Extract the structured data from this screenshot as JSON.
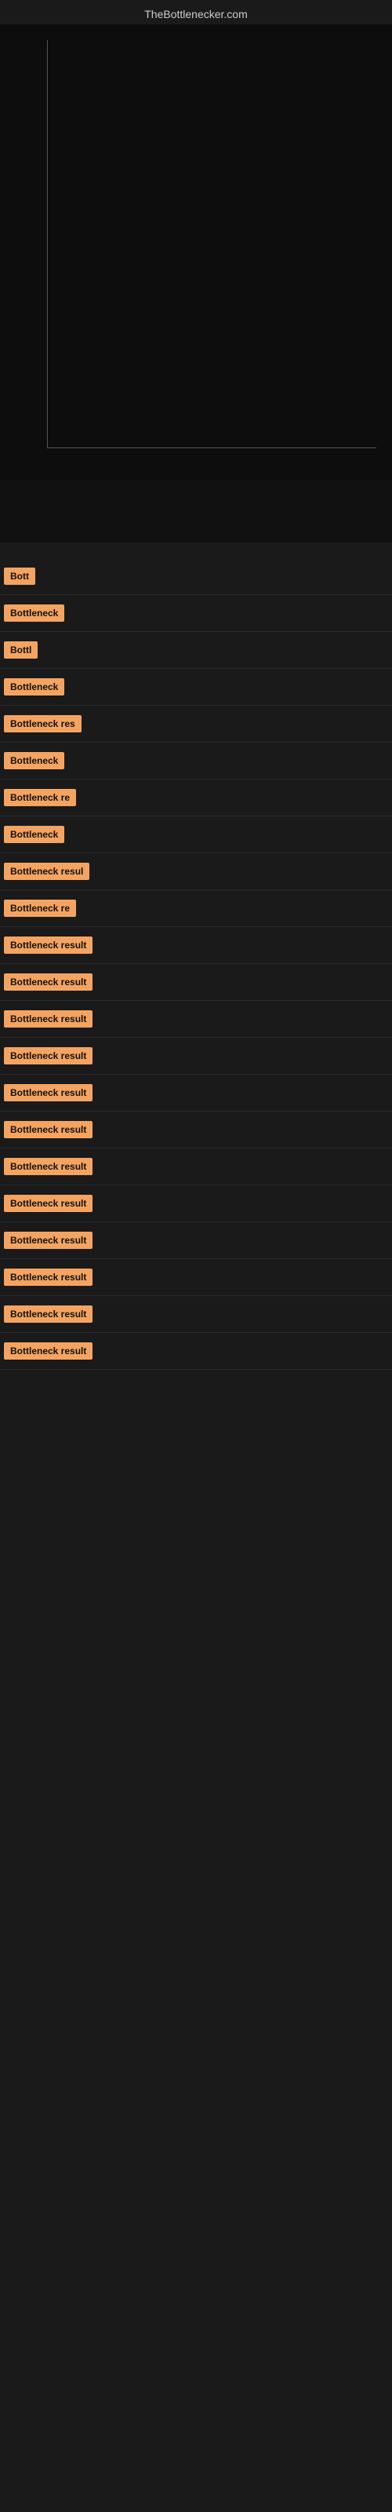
{
  "site": {
    "title": "TheBottlenecker.com"
  },
  "results": [
    {
      "id": 1,
      "label": "Bott",
      "full": false
    },
    {
      "id": 2,
      "label": "Bottleneck",
      "full": false
    },
    {
      "id": 3,
      "label": "Bottl",
      "full": false
    },
    {
      "id": 4,
      "label": "Bottleneck",
      "full": false
    },
    {
      "id": 5,
      "label": "Bottleneck res",
      "full": false
    },
    {
      "id": 6,
      "label": "Bottleneck",
      "full": false
    },
    {
      "id": 7,
      "label": "Bottleneck re",
      "full": false
    },
    {
      "id": 8,
      "label": "Bottleneck",
      "full": false
    },
    {
      "id": 9,
      "label": "Bottleneck resul",
      "full": false
    },
    {
      "id": 10,
      "label": "Bottleneck re",
      "full": false
    },
    {
      "id": 11,
      "label": "Bottleneck result",
      "full": true
    },
    {
      "id": 12,
      "label": "Bottleneck result",
      "full": true
    },
    {
      "id": 13,
      "label": "Bottleneck result",
      "full": true
    },
    {
      "id": 14,
      "label": "Bottleneck result",
      "full": true
    },
    {
      "id": 15,
      "label": "Bottleneck result",
      "full": true
    },
    {
      "id": 16,
      "label": "Bottleneck result",
      "full": true
    },
    {
      "id": 17,
      "label": "Bottleneck result",
      "full": true
    },
    {
      "id": 18,
      "label": "Bottleneck result",
      "full": true
    },
    {
      "id": 19,
      "label": "Bottleneck result",
      "full": true
    },
    {
      "id": 20,
      "label": "Bottleneck result",
      "full": true
    },
    {
      "id": 21,
      "label": "Bottleneck result",
      "full": true
    },
    {
      "id": 22,
      "label": "Bottleneck result",
      "full": true
    }
  ],
  "colors": {
    "badge": "#f4a460",
    "background": "#1a1a1a",
    "chartBg": "#0d0d0d"
  }
}
